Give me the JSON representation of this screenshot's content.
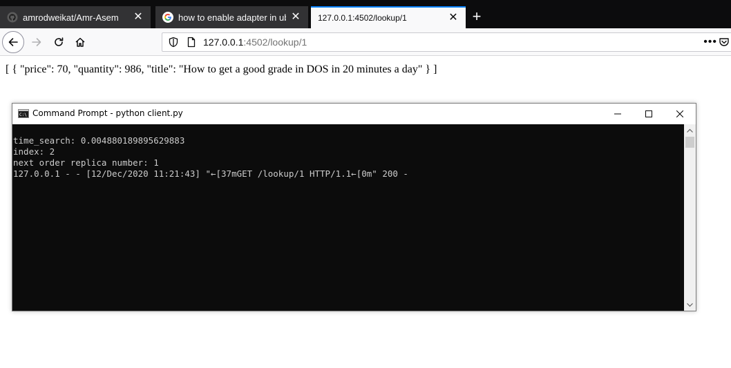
{
  "browser": {
    "tabs": [
      {
        "title": "amrodweikat/Amr-Asem",
        "favicon": "github-icon",
        "active": false
      },
      {
        "title": "how to enable adapter in ubun",
        "favicon": "google-icon",
        "active": false
      },
      {
        "title": "127.0.0.1:4502/lookup/1",
        "favicon": "",
        "active": true
      }
    ],
    "new_tab_label": "+",
    "url_host": "127.0.0.1",
    "url_rest": ":4502/lookup/1",
    "more_label": "•••",
    "colors": {
      "tabstrip_bg": "#0c0c0d",
      "active_tab_accent": "#0a84ff"
    }
  },
  "page": {
    "json_text": "[ { \"price\": 70, \"quantity\": 986, \"title\": \"How to get a good grade in DOS in 20 minutes a day\" } ]"
  },
  "cmd": {
    "title": "Command Prompt - python  client.py",
    "icon": "cmd-icon",
    "lines": [
      "time_search: 0.004880189895629883",
      "index: 2",
      "next order replica number: 1",
      "127.0.0.1 - - [12/Dec/2020 11:21:43] \"←[37mGET /lookup/1 HTTP/1.1←[0m\" 200 -"
    ],
    "colors": {
      "console_bg": "#0c0c0c",
      "console_text": "#cccccc"
    }
  }
}
